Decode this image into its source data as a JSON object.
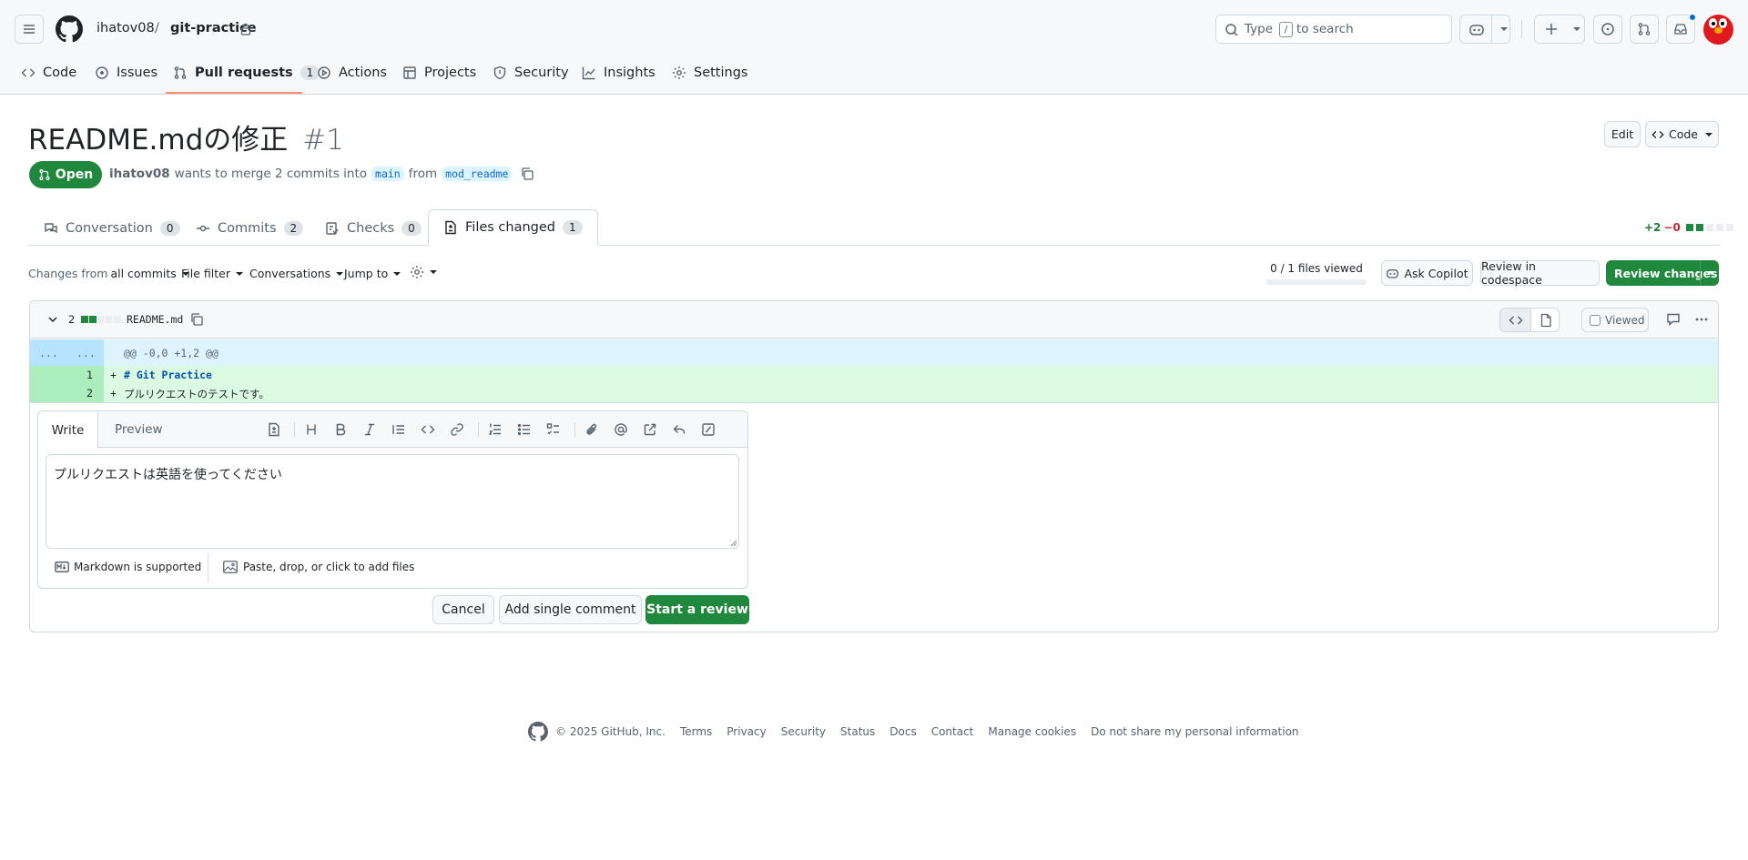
{
  "header": {
    "owner": "ihatov08",
    "separator": "/",
    "repo": "git-practice",
    "search_placeholder": "Type / to search",
    "search_prefix": "Type",
    "search_key": "/",
    "search_suffix": "to search"
  },
  "repo_nav": [
    {
      "label": "Code",
      "icon": "code-icon"
    },
    {
      "label": "Issues",
      "icon": "issue-icon"
    },
    {
      "label": "Pull requests",
      "icon": "pull-request-icon",
      "count": "1"
    },
    {
      "label": "Actions",
      "icon": "play-icon"
    },
    {
      "label": "Projects",
      "icon": "table-icon"
    },
    {
      "label": "Security",
      "icon": "shield-icon"
    },
    {
      "label": "Insights",
      "icon": "graph-icon"
    },
    {
      "label": "Settings",
      "icon": "gear-icon"
    }
  ],
  "pr": {
    "title": "README.mdの修正",
    "number": "#1",
    "state": "Open",
    "author": "ihatov08",
    "merge_text": "wants to merge 2 commits into",
    "base": "main",
    "from_text": "from",
    "head": "mod_readme",
    "edit_label": "Edit",
    "code_label": "Code"
  },
  "pr_tabs": [
    {
      "label": "Conversation",
      "count": "0"
    },
    {
      "label": "Commits",
      "count": "2"
    },
    {
      "label": "Checks",
      "count": "0"
    },
    {
      "label": "Files changed",
      "count": "1"
    }
  ],
  "diffstat": {
    "additions": "+2",
    "deletions": "−0"
  },
  "files_toolbar": {
    "changes_from_prefix": "Changes from",
    "changes_from_value": "all commits",
    "file_filter": "File filter",
    "conversations": "Conversations",
    "jump_to": "Jump to",
    "files_viewed": "0 / 1 files viewed",
    "ask_copilot": "Ask Copilot",
    "review_codespace": "Review in codespace",
    "review_changes": "Review changes"
  },
  "file": {
    "changes_count": "2",
    "name": "README.md",
    "viewed_label": "Viewed",
    "hunk_left": "...",
    "hunk_right": "...",
    "hunk_header": "@@ -0,0 +1,2 @@",
    "lines": [
      {
        "num": "1",
        "sign": "+",
        "text": "# Git Practice"
      },
      {
        "num": "2",
        "sign": "+",
        "text": "プルリクエストのテストです。"
      }
    ]
  },
  "comment": {
    "write_tab": "Write",
    "preview_tab": "Preview",
    "body": "プルリクエストは英語を使ってください",
    "markdown_supported": "Markdown is supported",
    "attach_files": "Paste, drop, or click to add files",
    "cancel": "Cancel",
    "add_single": "Add single comment",
    "start_review": "Start a review"
  },
  "footer": {
    "copyright": "© 2025 GitHub, Inc.",
    "links": [
      "Terms",
      "Privacy",
      "Security",
      "Status",
      "Docs",
      "Contact",
      "Manage cookies",
      "Do not share my personal information"
    ]
  },
  "colors": {
    "accent_green": "#1f883d",
    "underline_orange": "#fd8c73",
    "addition_bg": "#dafbe1",
    "hunk_bg": "#ddf4ff"
  }
}
